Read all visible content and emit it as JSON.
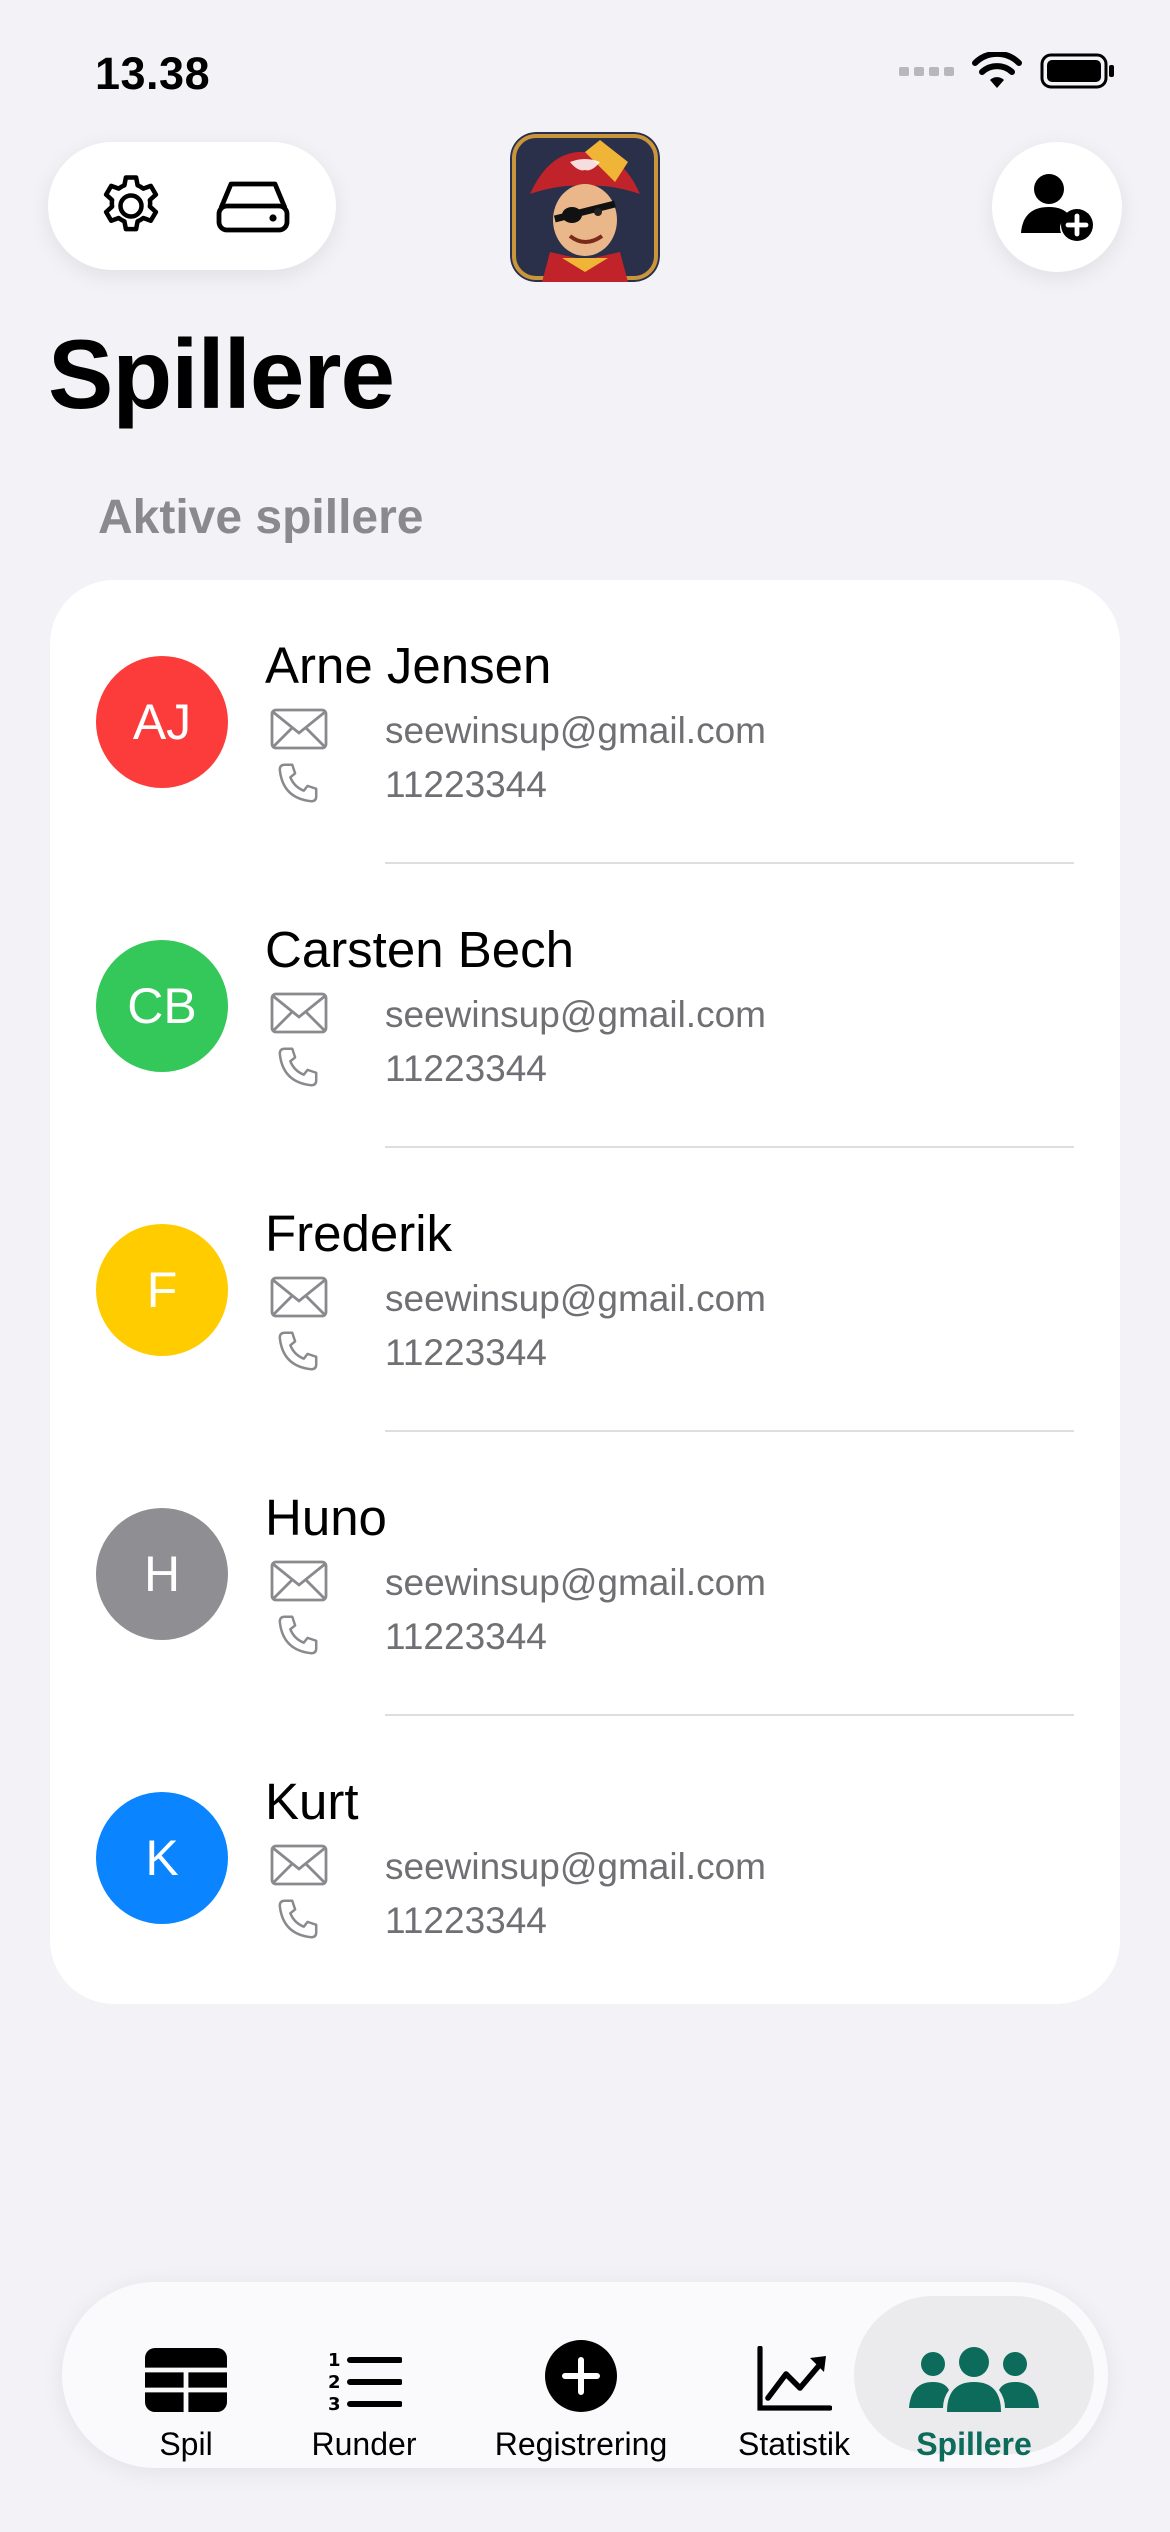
{
  "status_bar": {
    "time": "13.38"
  },
  "header": {
    "title": "Spillere"
  },
  "section": {
    "label": "Aktive spillere"
  },
  "players": [
    {
      "initials": "AJ",
      "name": "Arne Jensen",
      "email": "seewinsup@gmail.com",
      "phone": "11223344",
      "color": "#fc3b3b"
    },
    {
      "initials": "CB",
      "name": "Carsten Bech",
      "email": "seewinsup@gmail.com",
      "phone": "11223344",
      "color": "#34c759"
    },
    {
      "initials": "F",
      "name": "Frederik",
      "email": "seewinsup@gmail.com",
      "phone": "11223344",
      "color": "#ffcc00"
    },
    {
      "initials": "H",
      "name": "Huno",
      "email": "seewinsup@gmail.com",
      "phone": "11223344",
      "color": "#8e8e93"
    },
    {
      "initials": "K",
      "name": "Kurt",
      "email": "seewinsup@gmail.com",
      "phone": "11223344",
      "color": "#0a84ff"
    }
  ],
  "tabs": [
    {
      "label": "Spil",
      "icon": "table-grid-icon"
    },
    {
      "label": "Runder",
      "icon": "numbered-list-icon"
    },
    {
      "label": "Registrering",
      "icon": "plus-circle-icon"
    },
    {
      "label": "Statistik",
      "icon": "chart-line-icon"
    },
    {
      "label": "Spillere",
      "icon": "people-icon",
      "active": true
    }
  ],
  "colors": {
    "accent": "#0c6b5a",
    "background": "#f2f2f7"
  }
}
